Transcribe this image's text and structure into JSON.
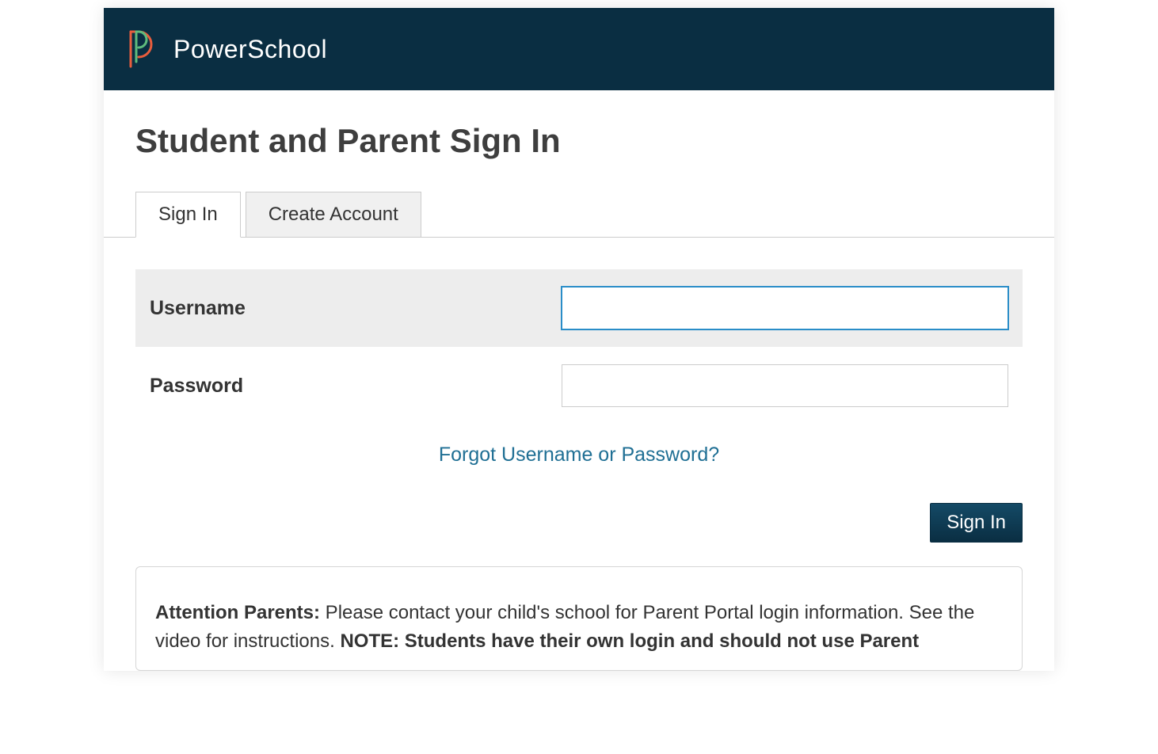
{
  "header": {
    "brand": "PowerSchool"
  },
  "page": {
    "title": "Student and Parent Sign In"
  },
  "tabs": {
    "signin": "Sign In",
    "create": "Create Account"
  },
  "form": {
    "username_label": "Username",
    "username_value": "",
    "password_label": "Password",
    "password_value": "",
    "forgot_link": "Forgot Username or Password?",
    "signin_button": "Sign In"
  },
  "notice": {
    "lead_bold": "Attention Parents:",
    "lead_text": " Please contact your child's school for Parent Portal login information. See the video for instructions. ",
    "note_bold": "NOTE: Students have their own login and should not use Parent"
  }
}
